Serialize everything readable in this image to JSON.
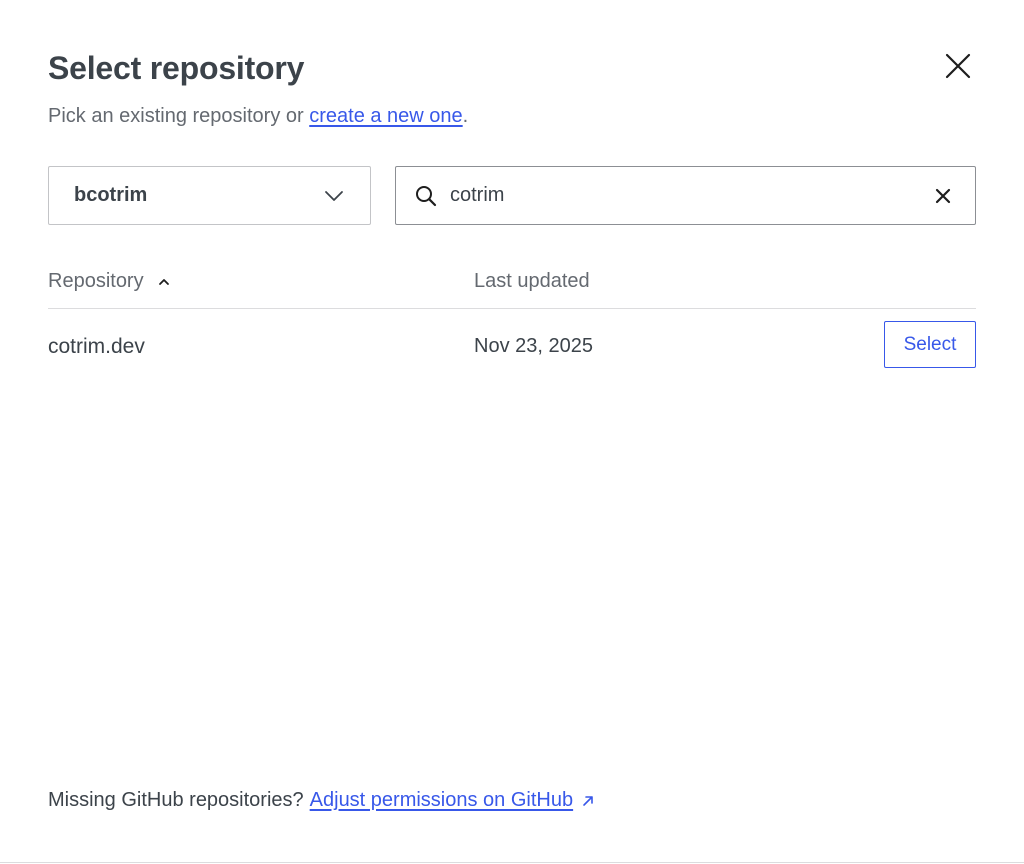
{
  "dialog": {
    "title": "Select repository",
    "subtitle_prefix": "Pick an existing repository or ",
    "subtitle_link": "create a new one",
    "subtitle_suffix": "."
  },
  "owner_select": {
    "value": "bcotrim",
    "icon": "chevron-down-icon"
  },
  "search": {
    "value": "cotrim",
    "placeholder": "",
    "icon": "search-icon",
    "clear_icon": "clear-icon"
  },
  "table": {
    "columns": [
      {
        "label": "Repository",
        "sort": "ascending",
        "icon": "chevron-up-icon"
      },
      {
        "label": "Last updated"
      }
    ],
    "rows": [
      {
        "name": "cotrim.dev",
        "last_updated": "Nov 23, 2025",
        "action_label": "Select"
      }
    ]
  },
  "footer": {
    "text": "Missing GitHub repositories?",
    "link": "Adjust permissions on GitHub",
    "icon": "external-link-icon"
  },
  "colors": {
    "accent": "#3858e9",
    "text": "#3c434a",
    "muted": "#646970",
    "border": "#c3c4c7",
    "divider": "#dcdcde"
  }
}
